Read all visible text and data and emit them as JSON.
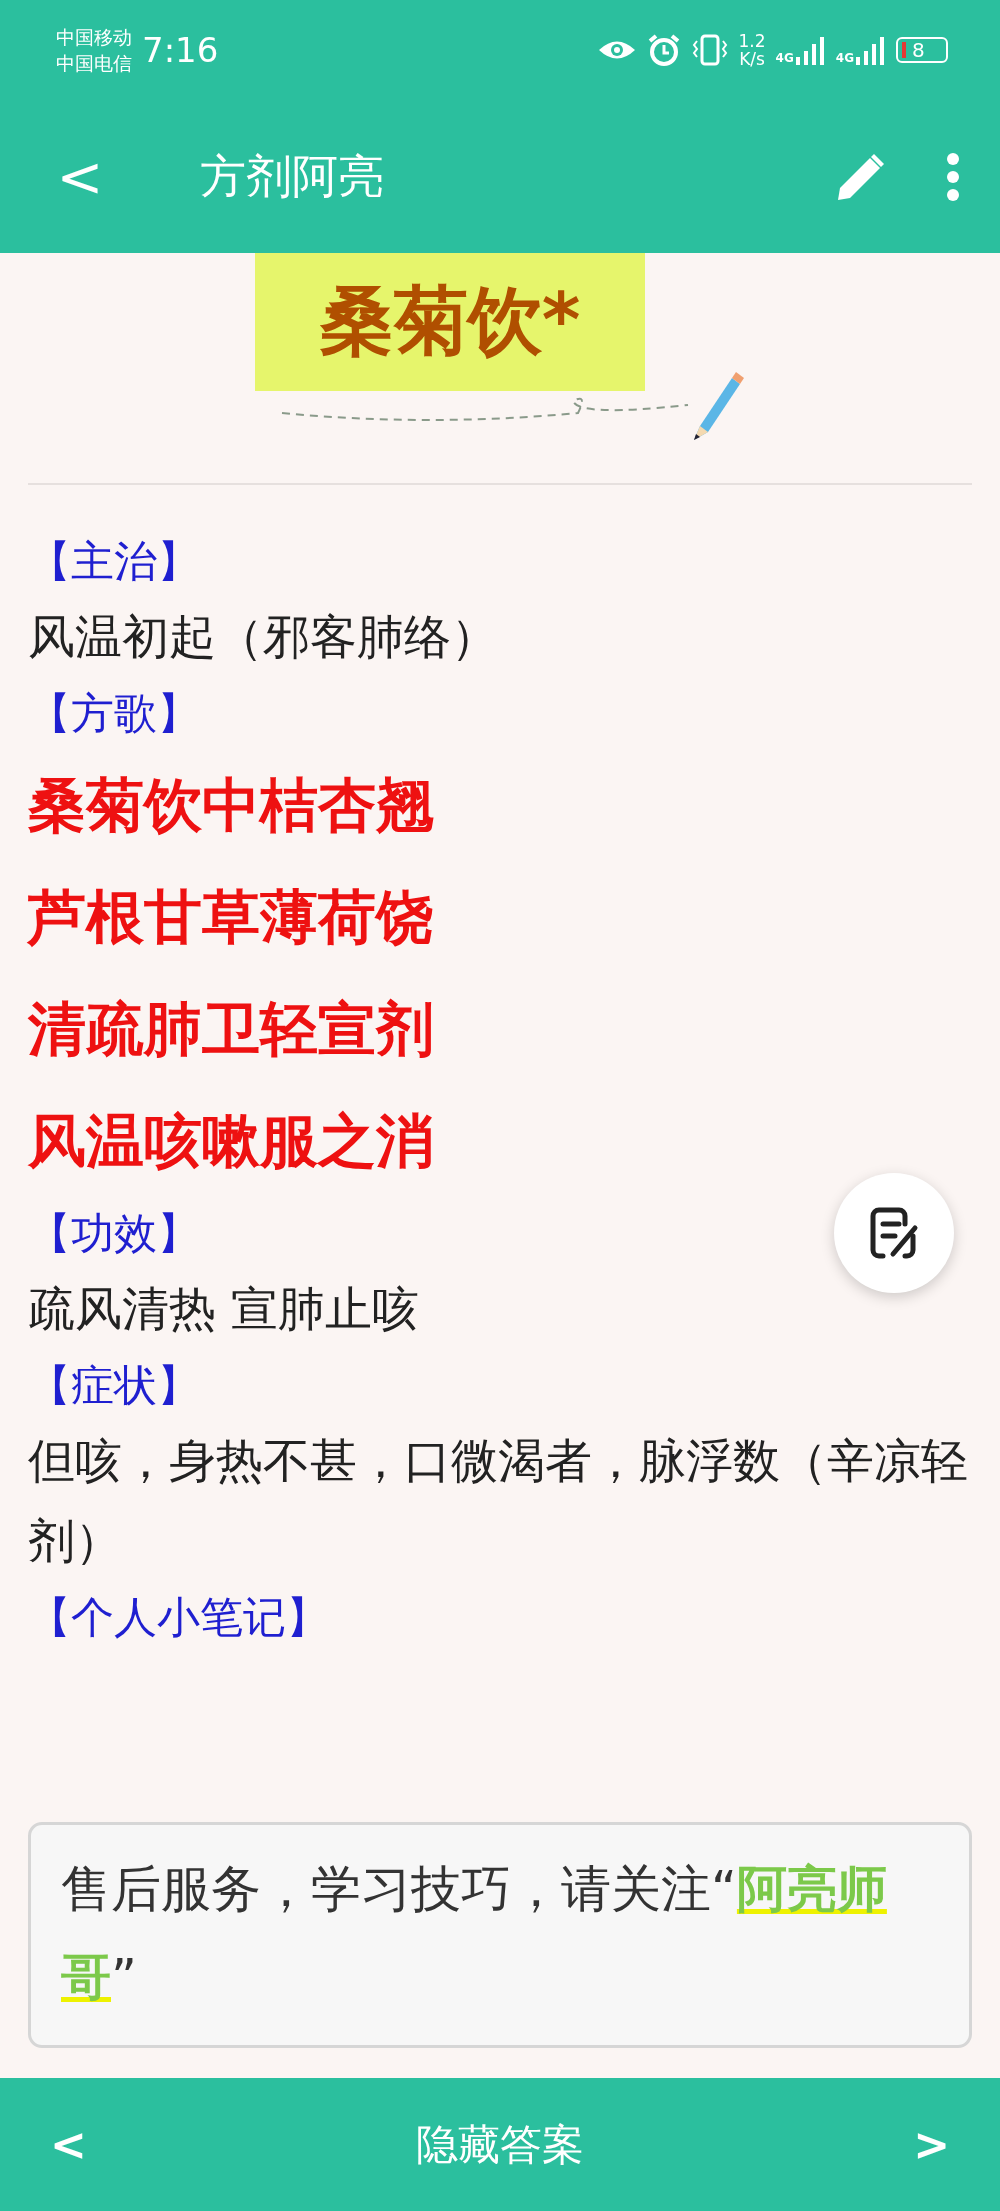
{
  "status_bar": {
    "carriers": [
      "中国移动",
      "中国电信"
    ],
    "time": "7:16",
    "net_speed": [
      "1.2",
      "K/s"
    ],
    "signals": [
      "4G",
      "4G"
    ],
    "battery": "8"
  },
  "app_bar": {
    "back": "<",
    "title": "方剂阿亮"
  },
  "banner": {
    "title": "桑菊饮*"
  },
  "sections": [
    {
      "kind": "label",
      "text": "【主治】"
    },
    {
      "kind": "text",
      "text": "风温初起（邪客肺络）"
    },
    {
      "kind": "label",
      "text": "【方歌】"
    },
    {
      "kind": "verse",
      "text": "桑菊饮中桔杏翘"
    },
    {
      "kind": "verse",
      "text": "芦根甘草薄荷饶"
    },
    {
      "kind": "verse",
      "text": "清疏肺卫轻宣剂"
    },
    {
      "kind": "verse",
      "text": "风温咳嗽服之消"
    },
    {
      "kind": "label",
      "text": "【功效】"
    },
    {
      "kind": "text",
      "text": "疏风清热 宣肺止咳"
    },
    {
      "kind": "label",
      "text": "【症状】"
    },
    {
      "kind": "text",
      "text": "但咳，身热不甚，口微渴者，脉浮数（辛凉轻剂）"
    },
    {
      "kind": "label",
      "text": "【个人小笔记】"
    }
  ],
  "notice": "售后服务，学习技巧，请关注“**阿亮师哥**”",
  "bottom_bar": {
    "prev": "<",
    "label": "隐藏答案",
    "next": ">"
  }
}
